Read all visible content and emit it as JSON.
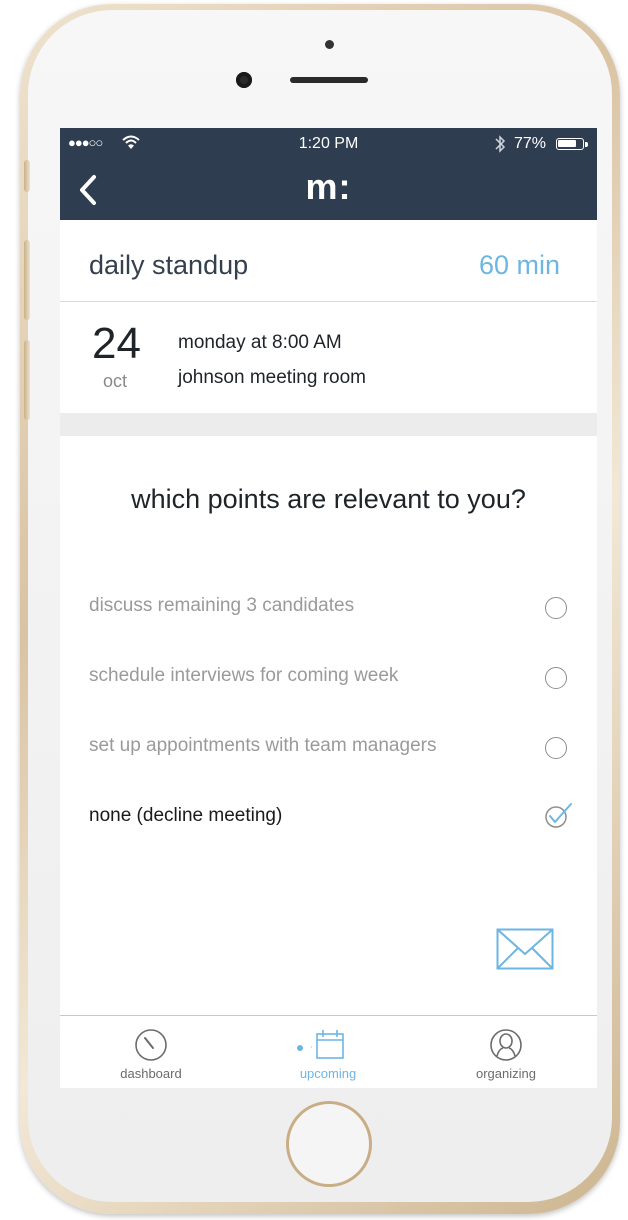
{
  "status_bar": {
    "signal": "●●●○○",
    "time": "1:20 PM",
    "battery": "77%"
  },
  "nav": {
    "logo": "m:"
  },
  "meeting": {
    "title": "daily standup",
    "duration": "60 min",
    "day": "24",
    "month": "oct",
    "when": "monday at 8:00 AM",
    "where": "johnson meeting room"
  },
  "question": "which points are relevant to you?",
  "options": [
    {
      "label": "discuss remaining 3 candidates",
      "selected": false
    },
    {
      "label": "schedule interviews for coming week",
      "selected": false
    },
    {
      "label": "set up appointments with team managers",
      "selected": false
    },
    {
      "label": "none (decline meeting)",
      "selected": true
    }
  ],
  "tabs": [
    {
      "label": "dashboard",
      "icon": "gauge-icon",
      "selected": false
    },
    {
      "label": "upcoming",
      "icon": "calendar-icon",
      "selected": true
    },
    {
      "label": "organizing",
      "icon": "user-icon",
      "selected": false
    }
  ],
  "colors": {
    "header_bg": "#2f3d50",
    "accent": "#6db6e3",
    "text_dark": "#1f2429",
    "text_muted": "#9a9a9a",
    "frame_gold": "#d9c3a2"
  }
}
